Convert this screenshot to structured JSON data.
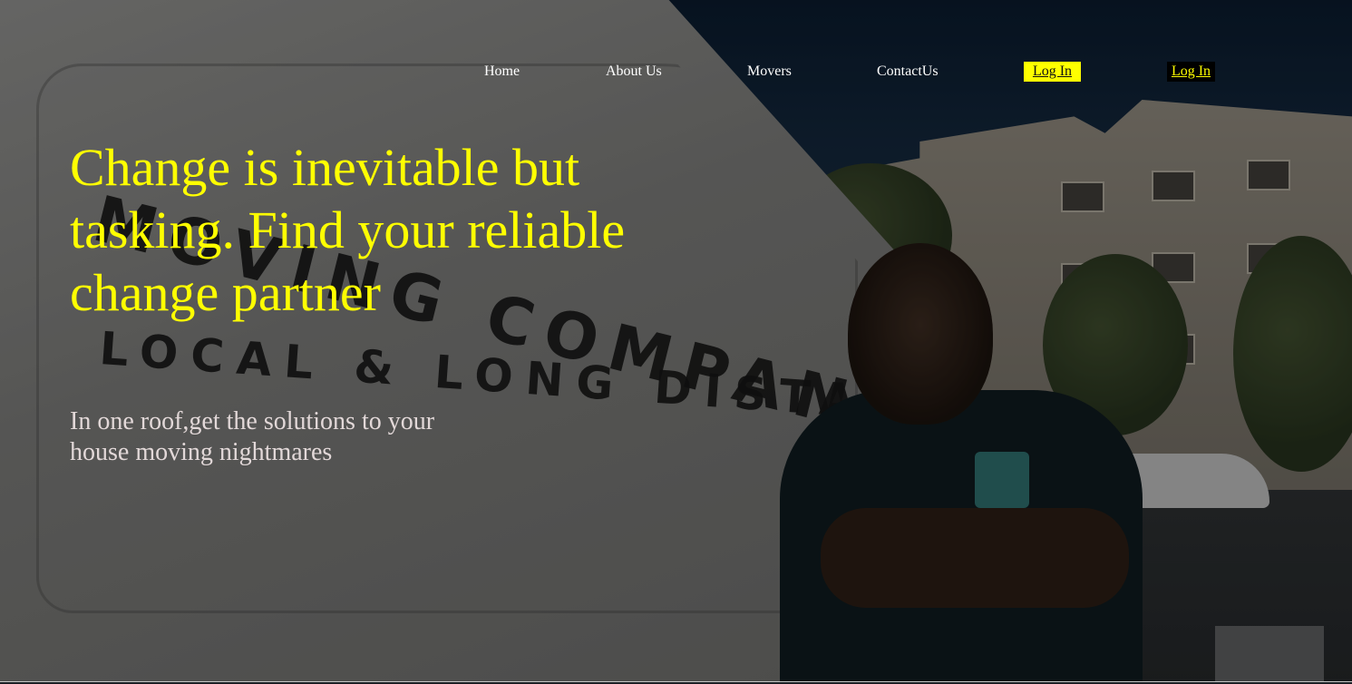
{
  "nav": {
    "items": [
      {
        "label": "Home"
      },
      {
        "label": "About Us"
      },
      {
        "label": "Movers"
      },
      {
        "label": "ContactUs"
      }
    ],
    "login_primary": "Log In",
    "login_secondary": "Log In"
  },
  "hero": {
    "headline": "Change is inevitable but tasking. Find your reliable change partner",
    "subheadline": "In one roof,get the solutions to your house moving nightmares",
    "background_lettering": {
      "line1": "MOVING COMPANY",
      "line2": "LOCAL & LONG DISTANCE"
    }
  },
  "colors": {
    "accent": "#ffff00",
    "nav_text": "#ffffff",
    "subheadline_text": "#e2d8d8",
    "login_dark_bg": "#000000"
  }
}
